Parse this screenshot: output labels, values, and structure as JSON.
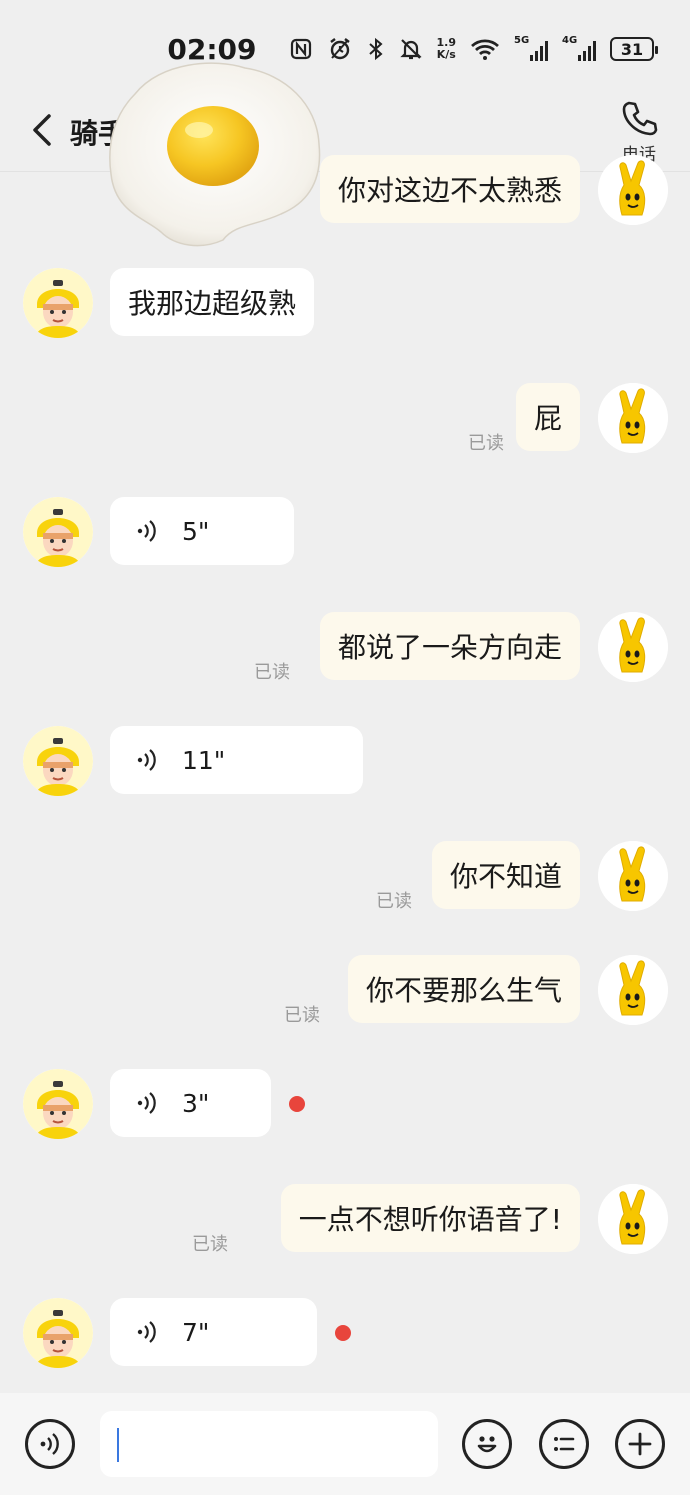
{
  "status_bar": {
    "time": "02:09",
    "net_speed_value": "1.9",
    "net_speed_unit": "K/s",
    "sim1_label": "5G",
    "sim2_label": "4G",
    "battery": "31",
    "icons": [
      "nfc-icon",
      "alarm-icon",
      "bluetooth-icon",
      "mute-icon",
      "wifi-icon"
    ]
  },
  "header": {
    "title": "骑手",
    "call_label": "电话"
  },
  "messages": [
    {
      "side": "out",
      "type": "text",
      "text": "你对这边不太熟悉",
      "read": ""
    },
    {
      "side": "in",
      "type": "text",
      "text": "我那边超级熟"
    },
    {
      "side": "out",
      "type": "text",
      "text": "屁",
      "read": "已读"
    },
    {
      "side": "in",
      "type": "voice",
      "duration": "5\""
    },
    {
      "side": "out",
      "type": "text",
      "text": "都说了一朵方向走",
      "read": "已读"
    },
    {
      "side": "in",
      "type": "voice",
      "duration": "11\""
    },
    {
      "side": "out",
      "type": "text",
      "text": "你不知道",
      "read": "已读"
    },
    {
      "side": "out",
      "type": "text",
      "text": "你不要那么生气",
      "read": "已读"
    },
    {
      "side": "in",
      "type": "voice",
      "duration": "3\"",
      "unread": true
    },
    {
      "side": "out",
      "type": "text",
      "text": "一点不想听你语音了!",
      "read": "已读"
    },
    {
      "side": "in",
      "type": "voice",
      "duration": "7\"",
      "unread": true
    }
  ],
  "input_bar": {
    "text_value": "",
    "icons": [
      "voice-input-icon",
      "emoji-icon",
      "quick-reply-icon",
      "add-icon"
    ]
  },
  "colors": {
    "background": "#efefef",
    "incoming_bubble": "#ffffff",
    "outgoing_bubble": "#fdf9ec",
    "unread_dot": "#e8453c",
    "caret": "#3a78e0"
  }
}
